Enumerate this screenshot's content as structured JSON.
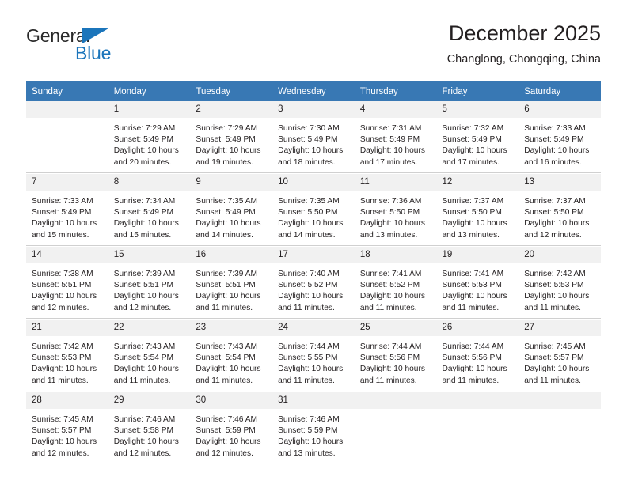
{
  "brand": {
    "name_part1": "General",
    "name_part2": "Blue",
    "triangle_color": "#1b75bb"
  },
  "header": {
    "title": "December 2025",
    "subtitle": "Changlong, Chongqing, China"
  },
  "colors": {
    "header_row": "#3878b4",
    "day_number_strip": "#f1f1f1",
    "text": "#231f20",
    "grid_line": "#d0d0d0"
  },
  "weekday_headers": [
    "Sunday",
    "Monday",
    "Tuesday",
    "Wednesday",
    "Thursday",
    "Friday",
    "Saturday"
  ],
  "weeks": [
    [
      {
        "day": "",
        "sunrise": "",
        "sunset": "",
        "daylight1": "",
        "daylight2": "",
        "empty": true
      },
      {
        "day": "1",
        "sunrise": "Sunrise: 7:29 AM",
        "sunset": "Sunset: 5:49 PM",
        "daylight1": "Daylight: 10 hours",
        "daylight2": "and 20 minutes.",
        "empty": false
      },
      {
        "day": "2",
        "sunrise": "Sunrise: 7:29 AM",
        "sunset": "Sunset: 5:49 PM",
        "daylight1": "Daylight: 10 hours",
        "daylight2": "and 19 minutes.",
        "empty": false
      },
      {
        "day": "3",
        "sunrise": "Sunrise: 7:30 AM",
        "sunset": "Sunset: 5:49 PM",
        "daylight1": "Daylight: 10 hours",
        "daylight2": "and 18 minutes.",
        "empty": false
      },
      {
        "day": "4",
        "sunrise": "Sunrise: 7:31 AM",
        "sunset": "Sunset: 5:49 PM",
        "daylight1": "Daylight: 10 hours",
        "daylight2": "and 17 minutes.",
        "empty": false
      },
      {
        "day": "5",
        "sunrise": "Sunrise: 7:32 AM",
        "sunset": "Sunset: 5:49 PM",
        "daylight1": "Daylight: 10 hours",
        "daylight2": "and 17 minutes.",
        "empty": false
      },
      {
        "day": "6",
        "sunrise": "Sunrise: 7:33 AM",
        "sunset": "Sunset: 5:49 PM",
        "daylight1": "Daylight: 10 hours",
        "daylight2": "and 16 minutes.",
        "empty": false
      }
    ],
    [
      {
        "day": "7",
        "sunrise": "Sunrise: 7:33 AM",
        "sunset": "Sunset: 5:49 PM",
        "daylight1": "Daylight: 10 hours",
        "daylight2": "and 15 minutes.",
        "empty": false
      },
      {
        "day": "8",
        "sunrise": "Sunrise: 7:34 AM",
        "sunset": "Sunset: 5:49 PM",
        "daylight1": "Daylight: 10 hours",
        "daylight2": "and 15 minutes.",
        "empty": false
      },
      {
        "day": "9",
        "sunrise": "Sunrise: 7:35 AM",
        "sunset": "Sunset: 5:49 PM",
        "daylight1": "Daylight: 10 hours",
        "daylight2": "and 14 minutes.",
        "empty": false
      },
      {
        "day": "10",
        "sunrise": "Sunrise: 7:35 AM",
        "sunset": "Sunset: 5:50 PM",
        "daylight1": "Daylight: 10 hours",
        "daylight2": "and 14 minutes.",
        "empty": false
      },
      {
        "day": "11",
        "sunrise": "Sunrise: 7:36 AM",
        "sunset": "Sunset: 5:50 PM",
        "daylight1": "Daylight: 10 hours",
        "daylight2": "and 13 minutes.",
        "empty": false
      },
      {
        "day": "12",
        "sunrise": "Sunrise: 7:37 AM",
        "sunset": "Sunset: 5:50 PM",
        "daylight1": "Daylight: 10 hours",
        "daylight2": "and 13 minutes.",
        "empty": false
      },
      {
        "day": "13",
        "sunrise": "Sunrise: 7:37 AM",
        "sunset": "Sunset: 5:50 PM",
        "daylight1": "Daylight: 10 hours",
        "daylight2": "and 12 minutes.",
        "empty": false
      }
    ],
    [
      {
        "day": "14",
        "sunrise": "Sunrise: 7:38 AM",
        "sunset": "Sunset: 5:51 PM",
        "daylight1": "Daylight: 10 hours",
        "daylight2": "and 12 minutes.",
        "empty": false
      },
      {
        "day": "15",
        "sunrise": "Sunrise: 7:39 AM",
        "sunset": "Sunset: 5:51 PM",
        "daylight1": "Daylight: 10 hours",
        "daylight2": "and 12 minutes.",
        "empty": false
      },
      {
        "day": "16",
        "sunrise": "Sunrise: 7:39 AM",
        "sunset": "Sunset: 5:51 PM",
        "daylight1": "Daylight: 10 hours",
        "daylight2": "and 11 minutes.",
        "empty": false
      },
      {
        "day": "17",
        "sunrise": "Sunrise: 7:40 AM",
        "sunset": "Sunset: 5:52 PM",
        "daylight1": "Daylight: 10 hours",
        "daylight2": "and 11 minutes.",
        "empty": false
      },
      {
        "day": "18",
        "sunrise": "Sunrise: 7:41 AM",
        "sunset": "Sunset: 5:52 PM",
        "daylight1": "Daylight: 10 hours",
        "daylight2": "and 11 minutes.",
        "empty": false
      },
      {
        "day": "19",
        "sunrise": "Sunrise: 7:41 AM",
        "sunset": "Sunset: 5:53 PM",
        "daylight1": "Daylight: 10 hours",
        "daylight2": "and 11 minutes.",
        "empty": false
      },
      {
        "day": "20",
        "sunrise": "Sunrise: 7:42 AM",
        "sunset": "Sunset: 5:53 PM",
        "daylight1": "Daylight: 10 hours",
        "daylight2": "and 11 minutes.",
        "empty": false
      }
    ],
    [
      {
        "day": "21",
        "sunrise": "Sunrise: 7:42 AM",
        "sunset": "Sunset: 5:53 PM",
        "daylight1": "Daylight: 10 hours",
        "daylight2": "and 11 minutes.",
        "empty": false
      },
      {
        "day": "22",
        "sunrise": "Sunrise: 7:43 AM",
        "sunset": "Sunset: 5:54 PM",
        "daylight1": "Daylight: 10 hours",
        "daylight2": "and 11 minutes.",
        "empty": false
      },
      {
        "day": "23",
        "sunrise": "Sunrise: 7:43 AM",
        "sunset": "Sunset: 5:54 PM",
        "daylight1": "Daylight: 10 hours",
        "daylight2": "and 11 minutes.",
        "empty": false
      },
      {
        "day": "24",
        "sunrise": "Sunrise: 7:44 AM",
        "sunset": "Sunset: 5:55 PM",
        "daylight1": "Daylight: 10 hours",
        "daylight2": "and 11 minutes.",
        "empty": false
      },
      {
        "day": "25",
        "sunrise": "Sunrise: 7:44 AM",
        "sunset": "Sunset: 5:56 PM",
        "daylight1": "Daylight: 10 hours",
        "daylight2": "and 11 minutes.",
        "empty": false
      },
      {
        "day": "26",
        "sunrise": "Sunrise: 7:44 AM",
        "sunset": "Sunset: 5:56 PM",
        "daylight1": "Daylight: 10 hours",
        "daylight2": "and 11 minutes.",
        "empty": false
      },
      {
        "day": "27",
        "sunrise": "Sunrise: 7:45 AM",
        "sunset": "Sunset: 5:57 PM",
        "daylight1": "Daylight: 10 hours",
        "daylight2": "and 11 minutes.",
        "empty": false
      }
    ],
    [
      {
        "day": "28",
        "sunrise": "Sunrise: 7:45 AM",
        "sunset": "Sunset: 5:57 PM",
        "daylight1": "Daylight: 10 hours",
        "daylight2": "and 12 minutes.",
        "empty": false
      },
      {
        "day": "29",
        "sunrise": "Sunrise: 7:46 AM",
        "sunset": "Sunset: 5:58 PM",
        "daylight1": "Daylight: 10 hours",
        "daylight2": "and 12 minutes.",
        "empty": false
      },
      {
        "day": "30",
        "sunrise": "Sunrise: 7:46 AM",
        "sunset": "Sunset: 5:59 PM",
        "daylight1": "Daylight: 10 hours",
        "daylight2": "and 12 minutes.",
        "empty": false
      },
      {
        "day": "31",
        "sunrise": "Sunrise: 7:46 AM",
        "sunset": "Sunset: 5:59 PM",
        "daylight1": "Daylight: 10 hours",
        "daylight2": "and 13 minutes.",
        "empty": false
      },
      {
        "day": "",
        "sunrise": "",
        "sunset": "",
        "daylight1": "",
        "daylight2": "",
        "empty": true
      },
      {
        "day": "",
        "sunrise": "",
        "sunset": "",
        "daylight1": "",
        "daylight2": "",
        "empty": true
      },
      {
        "day": "",
        "sunrise": "",
        "sunset": "",
        "daylight1": "",
        "daylight2": "",
        "empty": true
      }
    ]
  ]
}
